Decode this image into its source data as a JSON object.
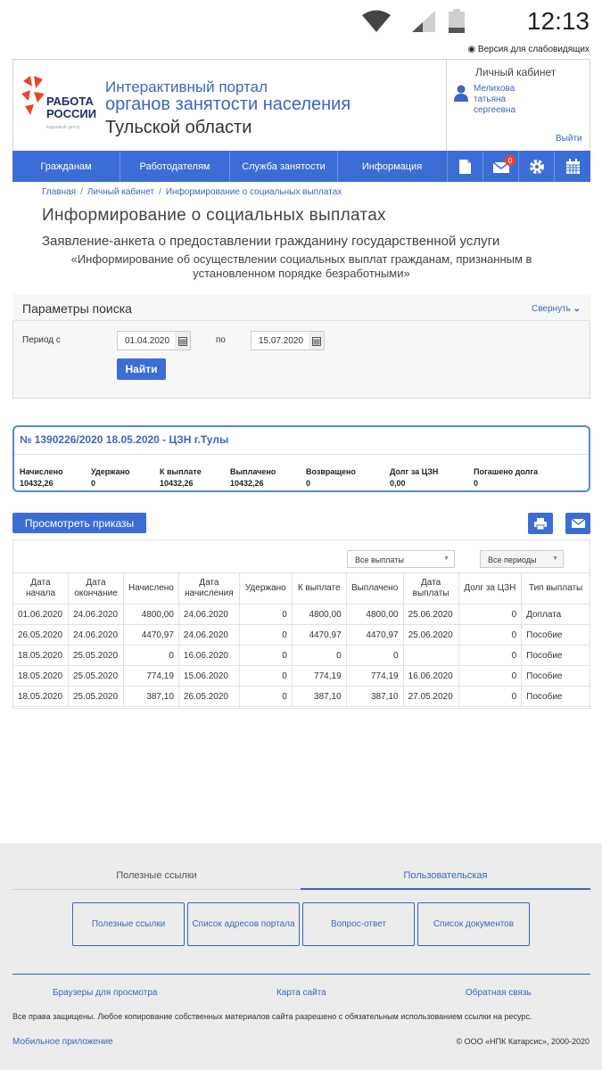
{
  "status_bar": {
    "time": "12:13"
  },
  "vision_link": "Версия для слабовидящих",
  "logo": {
    "line1": "РАБОТА",
    "line2": "РОССИИ",
    "sub": "кадровый центр"
  },
  "portal": {
    "line1": "Интерактивный портал",
    "line2": "органов занятости населения",
    "line3": "Тульской области"
  },
  "cabinet": {
    "title": "Личный кабинет",
    "user_line1": "Мелихова",
    "user_line2": "татьяна",
    "user_line3": "сергеевна",
    "exit": "Выйти"
  },
  "nav": {
    "items": [
      "Гражданам",
      "Работодателям",
      "Служба занятости",
      "Информация"
    ],
    "mail_badge": "0",
    "icons": [
      "document-icon",
      "mail-icon",
      "gear-icon",
      "calendar-icon"
    ]
  },
  "breadcrumbs": [
    "Главная",
    "Личный кабинет",
    "Информирование о социальных выплатах"
  ],
  "page": {
    "title": "Информирование о социальных выплатах",
    "subtitle": "Заявление-анкета о предоставлении гражданину государственной услуги",
    "service_line1": "«Информирование об осуществлении социальных выплат гражданам, признанным в",
    "service_line2": "установленном порядке безработными»"
  },
  "search": {
    "title": "Параметры поиска",
    "collapse": "Свернуть",
    "period_from_label": "Период с",
    "date_from": "01.04.2020",
    "to_label": "по",
    "date_to": "15.07.2020",
    "find": "Найти"
  },
  "record": {
    "title": "№ 1390226/2020 18.05.2020 - ЦЗН г.Тулы",
    "summary": [
      {
        "label": "Начислено",
        "value": "10432,26"
      },
      {
        "label": "Удержано",
        "value": "0"
      },
      {
        "label": "К выплате",
        "value": "10432,26"
      },
      {
        "label": "Выплачено",
        "value": "10432,26"
      },
      {
        "label": "Возвращено",
        "value": "0"
      },
      {
        "label": "Долг за ЦЗН",
        "value": "0,00"
      },
      {
        "label": "Погашено долга",
        "value": "0"
      }
    ]
  },
  "actions": {
    "view_orders": "Просмотреть приказы"
  },
  "filters": {
    "payments": "Все выплаты",
    "periods": "Все периоды"
  },
  "table": {
    "headers": [
      "Дата начала",
      "Дата окончание",
      "Начислено",
      "Дата начисления",
      "Удержано",
      "К выплате",
      "Выплачено",
      "Дата выплаты",
      "Долг за ЦЗН",
      "Тип выплаты"
    ],
    "rows": [
      [
        "01.06.2020",
        "24.06.2020",
        "4800,00",
        "24.06.2020",
        "0",
        "4800,00",
        "4800,00",
        "25.06.2020",
        "0",
        "Доплата"
      ],
      [
        "26.05.2020",
        "24.06.2020",
        "4470,97",
        "24.06.2020",
        "0",
        "4470,97",
        "4470,97",
        "25.06.2020",
        "0",
        "Пособие"
      ],
      [
        "18.05.2020",
        "25.05.2020",
        "0",
        "16.06.2020",
        "0",
        "0",
        "0",
        "",
        "0",
        "Пособие"
      ],
      [
        "18.05.2020",
        "25.05.2020",
        "774,19",
        "15.06.2020",
        "0",
        "774,19",
        "774,19",
        "16.06.2020",
        "0",
        "Пособие"
      ],
      [
        "18.05.2020",
        "25.05.2020",
        "387,10",
        "26.05.2020",
        "0",
        "387,10",
        "387,10",
        "27.05.2020",
        "0",
        "Пособие"
      ]
    ]
  },
  "footer": {
    "tab_useful": "Полезные ссылки",
    "tab_user": "Пользовательская",
    "boxes": [
      "Полезные ссылки",
      "Список адресов портала",
      "Вопрос-ответ",
      "Список документов"
    ],
    "links": [
      "Браузеры для просмотра",
      "Карта сайта",
      "Обратная связь"
    ],
    "rights": "Все права защищены. Любое копирование собственных материалов сайта разрешено с обязательным использованием ссылки на ресурс.",
    "mobile": "Мобильное приложение",
    "copyright": "© ООО «НПК Катарсис», 2000-2020"
  }
}
